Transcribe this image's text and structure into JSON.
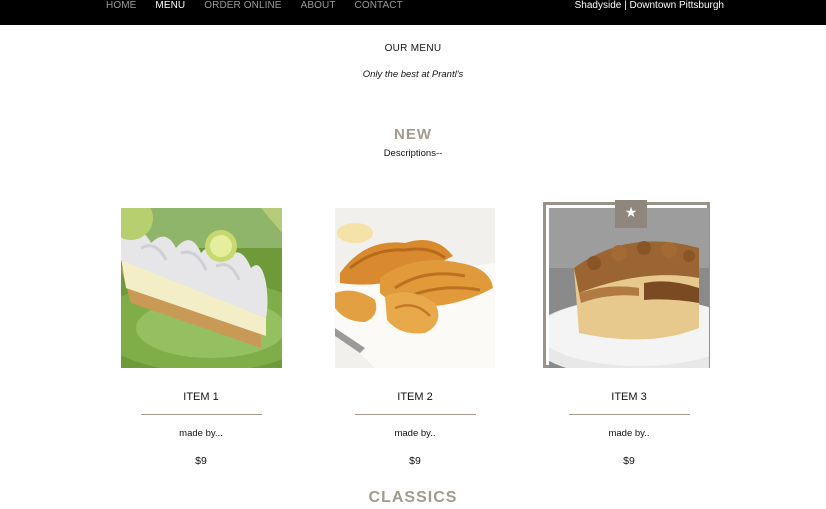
{
  "nav": {
    "items": [
      {
        "label": "HOME",
        "active": false
      },
      {
        "label": "MENU",
        "active": true
      },
      {
        "label": "ORDER ONLINE",
        "active": false
      },
      {
        "label": "ABOUT",
        "active": false
      },
      {
        "label": "CONTACT",
        "active": false
      }
    ],
    "location": "Shadyside | Downtown Pittsburgh"
  },
  "header": {
    "title": "OUR MENU",
    "tagline": "Only the best at Prantl's"
  },
  "new_section": {
    "title": "NEW",
    "description": "Descriptions--",
    "items": [
      {
        "name": "ITEM 1",
        "made_by": "made by...",
        "price": "$9",
        "image": "key-lime-pie",
        "featured": false
      },
      {
        "name": "ITEM 2",
        "made_by": "made by..",
        "price": "$9",
        "image": "croissants",
        "featured": false
      },
      {
        "name": "ITEM 3",
        "made_by": "made by..",
        "price": "$9",
        "image": "coffee-cake",
        "featured": true
      }
    ]
  },
  "classics_section": {
    "title": "CLASSICS"
  },
  "colors": {
    "accent": "#a39a8e",
    "nav_bg": "#000000",
    "badge": "#8f877d"
  },
  "icons": {
    "featured_badge": "star-icon"
  }
}
